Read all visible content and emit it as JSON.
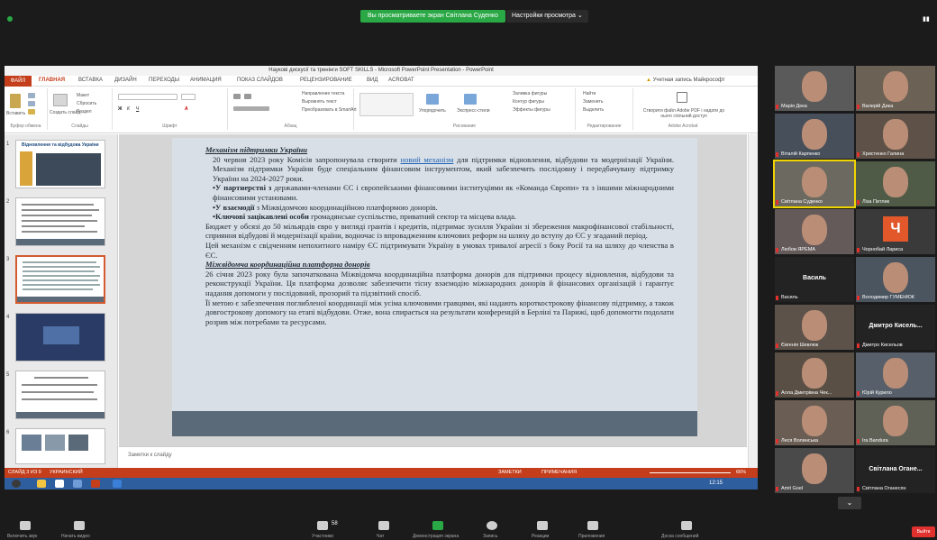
{
  "zoom": {
    "share_banner": "Вы просматриваете экран Світлана Суденко",
    "view_options": "Настройки просмотра",
    "leave": "Выйти"
  },
  "ppt": {
    "window_title": "Наукові дискусії та тренінги SOFT SKILLS - Microsoft PowerPoint Presentation - PowerPoint",
    "tabs": [
      "ФАЙЛ",
      "ГЛАВНАЯ",
      "ВСТАВКА",
      "ДИЗАЙН",
      "ПЕРЕХОДЫ",
      "АНИМАЦИЯ",
      "ПОКАЗ СЛАЙДОВ",
      "РЕЦЕНЗИРОВАНИЕ",
      "ВИД",
      "ACROBAT"
    ],
    "account": "Учетная запись Майкрософт",
    "ribbon_groups": [
      "Буфер обмена",
      "Слайды",
      "Шрифт",
      "Абзац",
      "Рисование",
      "Редактирование",
      "Adobe Acrobat"
    ],
    "ribbon_texts": {
      "paste": "Вставить",
      "new_slide": "Создать слайд",
      "layout": "Макет",
      "reset": "Сбросить",
      "section": "Раздел",
      "text_direction": "Направление текста",
      "align_text": "Выровнять текст",
      "smartart": "Преобразовать в SmartArt",
      "arrange": "Упорядочить",
      "quick_styles": "Экспресс-стили",
      "fill": "Заливка фигуры",
      "outline": "Контур фигуры",
      "effects": "Эффекты фигуры",
      "find": "Найти",
      "replace": "Заменить",
      "select": "Выделить",
      "adobe": "Створити файл Adobe PDF і надати до нього спільний доступ"
    },
    "thumb_title_1": "Відновлення та відбудова України",
    "notes_placeholder": "Заметки к слайду",
    "status": {
      "slide": "СЛАЙД 3 ИЗ 9",
      "lang": "УКРАИНСКИЙ",
      "notes": "ЗАМЕТКИ",
      "comments": "ПРИМЕЧАНИЯ",
      "zoom": "66%"
    },
    "clock": "12:15"
  },
  "slide": {
    "h1": "Механізм підтримки України",
    "p1a": "20 червня 2023 року Комісія запропонувала створити ",
    "p1link": "новий механізм",
    "p1b": " для підтримки відновлення, відбудови та модернізації України. Механізм підтримки України буде спеціальним фінансовим інструментом, який забезпечить послідовну і передбачувану підтримку України на 2024-2027 роки.",
    "b1bold": "•У партнерстві з",
    "b1": " державами-членами ЄС і європейськими фінансовими інституціями як «Команда Європи» та з іншими міжнародними фінансовими установами.",
    "b2bold": "•У взаємодії",
    "b2": " з Міжвідомчою координаційною платформою донорів.",
    "b3bold": "•Ключові зацікавлені особи",
    "b3": " громадянське суспільство, приватний сектор та місцева влада.",
    "p2": "Бюджет у обсязі до 50 мільярдів євро у вигляді грантів і кредитів, підтримає зусилля України зі збереження макрофінансової стабільності, сприяння відбудові й модернізації країни, водночас із впровадженням ключових реформ на шляху до вступу до ЄС у згаданий період.",
    "p3": "Цей механізм є свідченням непохитного наміру ЄС підтримувати Україну в умовах тривалої агресії з боку Росії та на шляху до членства в ЄС.",
    "h2": "Міжвідомча координаційна платформа донорів",
    "p4": "26 січня 2023 року була започаткована Міжвідомча координаційна платформа донорів для підтримки процесу відновлення, відбудови та реконструкції України. Ця платформа дозволяє забезпечити тісну взаємодію міжнародних донорів й фінансових організацій і гарантує надання допомоги у послідовний, прозорий та підзвітний спосіб.",
    "p5": "Її метою є забезпечення поглибленої координації між усіма ключовими гравцями, які надають короткострокову фінансову підтримку, а також довгострокову допомогу на етапі відбудови. Отже, вона спирається на результати конференцій в Берліні та Парижі, щоб допомогти подолати розрив між потребами та ресурсами."
  },
  "participants": [
    {
      "name": "Марія Дека"
    },
    {
      "name": "Валерій Дика"
    },
    {
      "name": "Віталій Карпенко"
    },
    {
      "name": "Христенко Галина"
    },
    {
      "name": "Світлана Суденко"
    },
    {
      "name": "Ліза Питлик"
    },
    {
      "name": "Любов ЯРЕМА"
    },
    {
      "name": "Чорнобай Лариса",
      "initial": "Ч"
    },
    {
      "name": "Василь",
      "big": "Василь"
    },
    {
      "name": "Володимир ГУМЕНЮК"
    },
    {
      "name": "Євгенія Шевлюк"
    },
    {
      "name": "Дмитро Кисельов",
      "big": "Дмитро Кисель..."
    },
    {
      "name": "Алла Дмитрівна Чек..."
    },
    {
      "name": "Юрій Курило"
    },
    {
      "name": "Леся Волинська"
    },
    {
      "name": "Ira Bandura"
    },
    {
      "name": "Amit Goel"
    },
    {
      "name": "Світлана Оганесян",
      "big": "Світлана Огане..."
    }
  ],
  "bottom_bar": {
    "items": [
      "Включить звук",
      "Начать видео",
      "Участники",
      "Чат",
      "Демонстрация экрана",
      "Запись",
      "Реакции",
      "Приложения",
      "Доска сообщений"
    ],
    "participants_count": "58"
  }
}
